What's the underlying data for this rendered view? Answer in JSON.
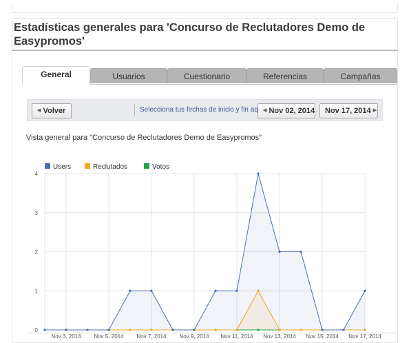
{
  "page": {
    "title": "Estadísticas generales para 'Concurso de Reclutadores Demo de Easypromos'"
  },
  "tabs": [
    {
      "label": "General",
      "active": true
    },
    {
      "label": "Usuarios",
      "active": false
    },
    {
      "label": "Cuestionario",
      "active": false
    },
    {
      "label": "Referencias",
      "active": false
    },
    {
      "label": "Campañas",
      "active": false
    }
  ],
  "toolbar": {
    "back_label": "Volver",
    "hint": "Selecciona tus fechas de inicio y fin aquí",
    "start_date": "Nov 02, 2014",
    "end_date": "Nov 17, 2014"
  },
  "chart_data": {
    "type": "area",
    "title": "Vista general para \"Concurso de Reclutadores Demo de Easypromos\"",
    "x": [
      "Nov 2, 2014",
      "Nov 3, 2014",
      "Nov 4, 2014",
      "Nov 5, 2014",
      "Nov 6, 2014",
      "Nov 7, 2014",
      "Nov 8, 2014",
      "Nov 9, 2014",
      "Nov 10, 2014",
      "Nov 11, 2014",
      "Nov 12, 2014",
      "Nov 13, 2014",
      "Nov 14, 2014",
      "Nov 15, 2014",
      "Nov 16, 2014",
      "Nov 17, 2014"
    ],
    "x_tick_labels": [
      "Nov 3, 2014",
      "Nov 5, 2014",
      "Nov 7, 2014",
      "Nov 9, 2014",
      "Nov 11, 2014",
      "Nov 13, 2014",
      "Nov 15, 2014",
      "Nov 17, 2014"
    ],
    "y_tick_labels": [
      "0",
      "1",
      "2",
      "3",
      "4"
    ],
    "ylim": [
      0,
      4
    ],
    "grid": true,
    "legend": "top-left",
    "series": [
      {
        "name": "Users",
        "color": "#4a6cb3",
        "values": [
          0,
          0,
          0,
          0,
          1,
          1,
          0,
          0,
          1,
          1,
          4,
          2,
          2,
          0,
          0,
          1
        ]
      },
      {
        "name": "Reclutados",
        "color": "#f5a623",
        "values": [
          0,
          0,
          0,
          0,
          0,
          0,
          0,
          0,
          0,
          0,
          1,
          0,
          0,
          0,
          0,
          0
        ]
      },
      {
        "name": "Votos",
        "color": "#1ea24a",
        "values": [
          0,
          0,
          0,
          0,
          0,
          0,
          0,
          0,
          0,
          0,
          0,
          0,
          0,
          0,
          0,
          0
        ]
      }
    ]
  }
}
